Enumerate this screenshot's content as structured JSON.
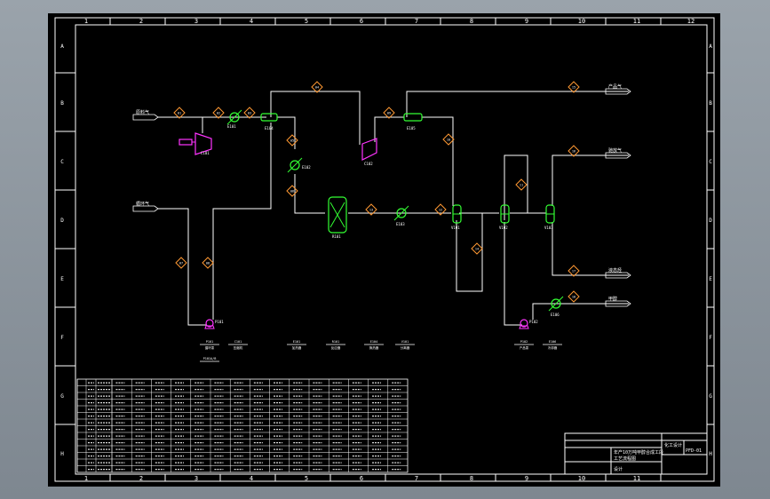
{
  "drawing": {
    "border_cols": [
      "1",
      "2",
      "3",
      "4",
      "5",
      "6",
      "7",
      "8",
      "9",
      "10",
      "11",
      "12"
    ],
    "border_cols_bottom": [
      "1",
      "2",
      "3",
      "4",
      "5",
      "6",
      "7",
      "8",
      "9",
      "10",
      "11"
    ],
    "border_rows": [
      "A",
      "B",
      "C",
      "D",
      "E",
      "F",
      "G",
      "H"
    ]
  },
  "colors": {
    "background": "#8a949e",
    "paper": "#000000",
    "line": "#ffffff",
    "equipment_green": "#33ff33",
    "equipment_magenta": "#ff33ff",
    "tag_orange": "#ff9933"
  },
  "streams": {
    "feed_top": "原料气",
    "feed_mid": "循环气",
    "prod_top_right": "产品气",
    "prod_mid_right": "驰放气",
    "prod_low_right": "液态烃",
    "prod_bottom_right": "甲醇"
  },
  "tags": [
    "01",
    "02",
    "03",
    "04",
    "05",
    "06",
    "07",
    "08",
    "09",
    "10",
    "11",
    "12",
    "13",
    "14",
    "15",
    "16",
    "17",
    "18"
  ],
  "equipment_labels": {
    "compressor_1": "C101",
    "compressor_2": "C102",
    "heater_1": "E101",
    "heater_2": "E102",
    "heater_3": "E103",
    "reactor": "R101",
    "exchanger_1": "E104",
    "exchanger_2": "E105",
    "separator_1": "V101",
    "separator_2": "V102",
    "separator_3": "V103",
    "pump_1": "P101",
    "pump_2": "P102",
    "cooler": "E106"
  },
  "legend_items": [
    {
      "code": "P101",
      "name": "循环泵"
    },
    {
      "code": "C101",
      "name": "压缩机"
    },
    {
      "code": "E101",
      "name": "加热器"
    },
    {
      "code": "R101",
      "name": "反应器"
    },
    {
      "code": "E104",
      "name": "换热器"
    },
    {
      "code": "V101",
      "name": "分离器"
    },
    {
      "code": "P102",
      "name": "产品泵"
    },
    {
      "code": "E106",
      "name": "冷却器"
    }
  ],
  "legend_sub": "P101A/B",
  "table": {
    "rows": 14,
    "cols": 18
  },
  "title_block": {
    "line1": "年产10万吨甲醇合成工段",
    "line2": "工艺流程图",
    "line3": "设计",
    "right1": "化工设计",
    "right2": "PFD-01"
  }
}
